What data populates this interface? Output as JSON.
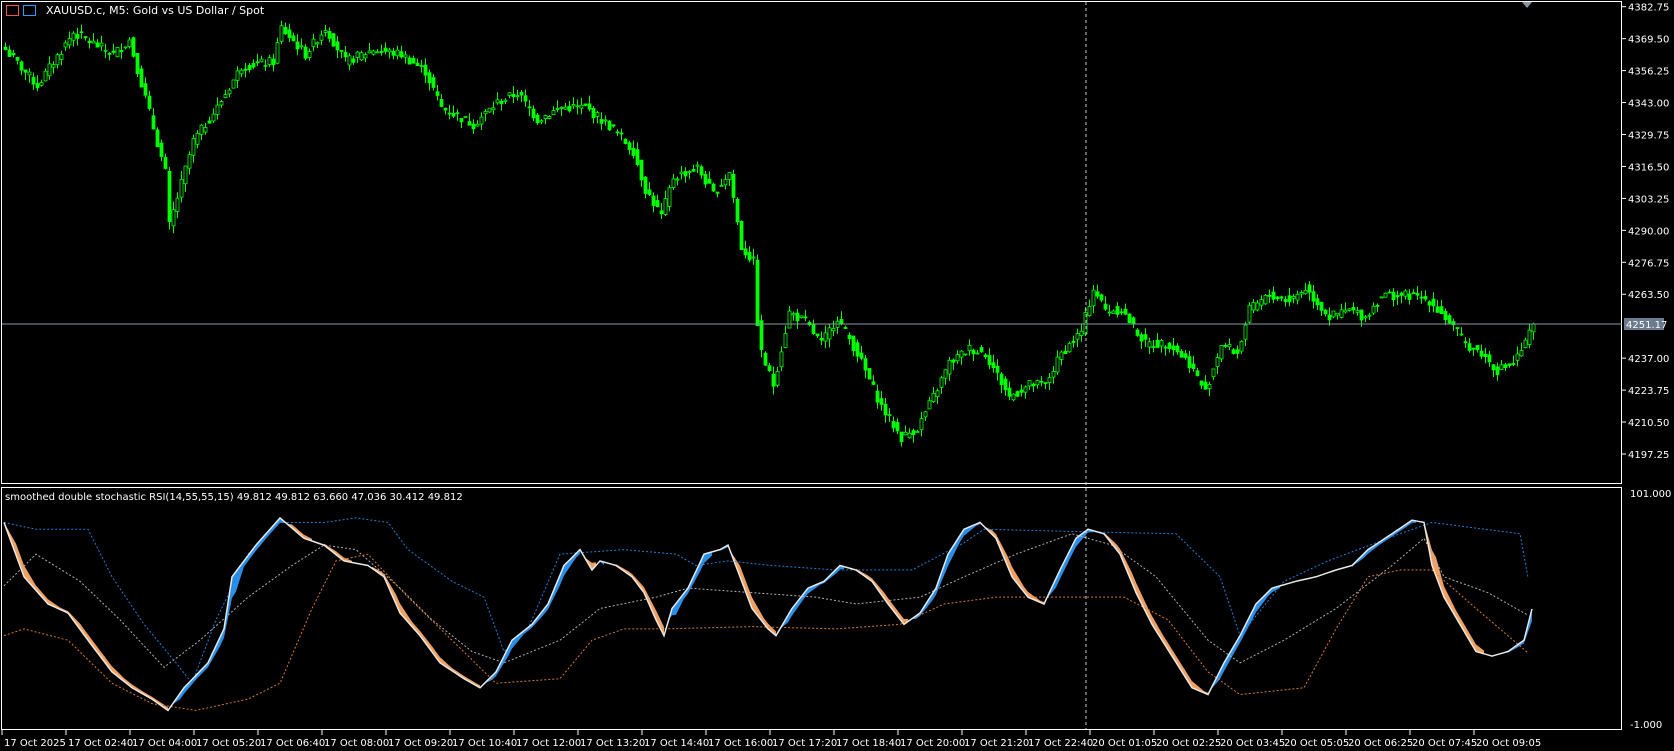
{
  "header": {
    "title": "XAUUSD.c, M5:  Gold vs US Dollar / Spot",
    "icons": [
      "chart-list-icon",
      "symbol-info-icon"
    ]
  },
  "indicator": {
    "title": "smoothed double stochastic RSI(14,55,55,15) 49.812 49.812 63.660 47.036 30.412 49.812"
  },
  "colors": {
    "candle": "#00ff00",
    "main": "#e8e8e8",
    "fill_up": "#2a8fe8",
    "fill_down": "#f0a060",
    "sig_blue": "#1e7fd8",
    "sig_gray": "#b0b0b0",
    "sig_orange": "#d87a30",
    "grid": "#ffffff",
    "current_price_bg": "#6b7a8c"
  },
  "chart_data": [
    {
      "type": "candlestick",
      "symbol": "XAUUSD.c",
      "timeframe": "M5",
      "ylim": [
        4190,
        4385
      ],
      "yticks": [
        "4382.75",
        "4369.50",
        "4356.25",
        "4343.00",
        "4329.75",
        "4316.50",
        "4303.25",
        "4290.00",
        "4276.75",
        "4263.50",
        "4237.00",
        "4223.75",
        "4210.50",
        "4197.25"
      ],
      "ytick_values": [
        4382.75,
        4369.5,
        4356.25,
        4343,
        4329.75,
        4316.5,
        4303.25,
        4290,
        4276.75,
        4263.5,
        4237,
        4223.75,
        4210.5,
        4197.25
      ],
      "current_price": "4251.17",
      "current_price_value": 4251.17,
      "close_anchors_bar_price": [
        [
          0,
          4365
        ],
        [
          8,
          4350
        ],
        [
          17,
          4372
        ],
        [
          27,
          4363
        ],
        [
          31,
          4369
        ],
        [
          35,
          4345
        ],
        [
          40,
          4314
        ],
        [
          41,
          4292
        ],
        [
          47,
          4327
        ],
        [
          53,
          4341
        ],
        [
          59,
          4358
        ],
        [
          67,
          4360
        ],
        [
          69,
          4374
        ],
        [
          75,
          4363
        ],
        [
          80,
          4374
        ],
        [
          85,
          4360
        ],
        [
          92,
          4365
        ],
        [
          99,
          4363
        ],
        [
          105,
          4356
        ],
        [
          109,
          4341
        ],
        [
          117,
          4334
        ],
        [
          123,
          4343
        ],
        [
          128,
          4347
        ],
        [
          133,
          4336
        ],
        [
          139,
          4341
        ],
        [
          145,
          4341
        ],
        [
          152,
          4332
        ],
        [
          157,
          4323
        ],
        [
          160,
          4307
        ],
        [
          164,
          4296
        ],
        [
          167,
          4312
        ],
        [
          173,
          4316
        ],
        [
          177,
          4305
        ],
        [
          181,
          4314
        ],
        [
          184,
          4283
        ],
        [
          187,
          4277
        ],
        [
          188,
          4252
        ],
        [
          189,
          4239
        ],
        [
          192,
          4226
        ],
        [
          196,
          4256
        ],
        [
          200,
          4252
        ],
        [
          204,
          4243
        ],
        [
          208,
          4254
        ],
        [
          213,
          4239
        ],
        [
          219,
          4217
        ],
        [
          224,
          4204
        ],
        [
          228,
          4208
        ],
        [
          232,
          4221
        ],
        [
          236,
          4235
        ],
        [
          241,
          4241
        ],
        [
          245,
          4239
        ],
        [
          251,
          4221
        ],
        [
          256,
          4226
        ],
        [
          260,
          4226
        ],
        [
          264,
          4239
        ],
        [
          269,
          4248
        ],
        [
          272,
          4266
        ],
        [
          275,
          4257
        ],
        [
          279,
          4257
        ],
        [
          285,
          4243
        ],
        [
          291,
          4243
        ],
        [
          296,
          4235
        ],
        [
          300,
          4223
        ],
        [
          304,
          4243
        ],
        [
          308,
          4239
        ],
        [
          311,
          4257
        ],
        [
          316,
          4263
        ],
        [
          321,
          4261
        ],
        [
          325,
          4266
        ],
        [
          331,
          4254
        ],
        [
          336,
          4257
        ],
        [
          340,
          4254
        ],
        [
          344,
          4263
        ],
        [
          351,
          4263
        ],
        [
          356,
          4261
        ],
        [
          361,
          4252
        ],
        [
          365,
          4243
        ],
        [
          369,
          4239
        ],
        [
          373,
          4232
        ],
        [
          377,
          4235
        ],
        [
          380,
          4243
        ],
        [
          382,
          4251.17
        ]
      ]
    },
    {
      "type": "line",
      "title": "smoothed double stochastic RSI(14,55,55,15)",
      "ylim": [
        -1,
        101
      ],
      "yticks": [
        "101.000",
        "-1.000"
      ],
      "ytick_values": [
        101,
        -1
      ],
      "series": [
        {
          "name": "main",
          "values": [
            [
              0,
              88
            ],
            [
              5,
              64
            ],
            [
              11,
              52
            ],
            [
              16,
              48
            ],
            [
              21,
              36
            ],
            [
              27,
              22
            ],
            [
              32,
              15
            ],
            [
              37,
              10
            ],
            [
              41,
              5
            ],
            [
              45,
              15
            ],
            [
              51,
              26
            ],
            [
              55,
              41
            ],
            [
              57,
              64
            ],
            [
              63,
              78
            ],
            [
              69,
              90
            ],
            [
              75,
              81
            ],
            [
              80,
              78
            ],
            [
              85,
              71
            ],
            [
              91,
              69
            ],
            [
              95,
              64
            ],
            [
              99,
              48
            ],
            [
              104,
              38
            ],
            [
              109,
              26
            ],
            [
              115,
              19
            ],
            [
              119,
              15
            ],
            [
              123,
              22
            ],
            [
              127,
              36
            ],
            [
              132,
              43
            ],
            [
              136,
              52
            ],
            [
              140,
              69
            ],
            [
              144,
              76
            ],
            [
              147,
              67
            ],
            [
              149,
              71
            ],
            [
              153,
              69
            ],
            [
              157,
              64
            ],
            [
              160,
              57
            ],
            [
              163,
              45
            ],
            [
              165,
              38
            ],
            [
              167,
              50
            ],
            [
              171,
              59
            ],
            [
              175,
              74
            ],
            [
              179,
              76
            ],
            [
              181,
              78
            ],
            [
              184,
              64
            ],
            [
              187,
              50
            ],
            [
              191,
              41
            ],
            [
              193,
              38
            ],
            [
              197,
              50
            ],
            [
              201,
              59
            ],
            [
              205,
              62
            ],
            [
              209,
              69
            ],
            [
              213,
              67
            ],
            [
              217,
              62
            ],
            [
              221,
              52
            ],
            [
              225,
              43
            ],
            [
              229,
              48
            ],
            [
              233,
              59
            ],
            [
              236,
              74
            ],
            [
              240,
              85
            ],
            [
              244,
              88
            ],
            [
              248,
              81
            ],
            [
              252,
              64
            ],
            [
              256,
              55
            ],
            [
              260,
              52
            ],
            [
              264,
              67
            ],
            [
              268,
              81
            ],
            [
              271,
              85
            ],
            [
              275,
              83
            ],
            [
              279,
              74
            ],
            [
              283,
              57
            ],
            [
              287,
              43
            ],
            [
              292,
              29
            ],
            [
              297,
              15
            ],
            [
              301,
              12
            ],
            [
              305,
              26
            ],
            [
              309,
              38
            ],
            [
              313,
              52
            ],
            [
              317,
              59
            ],
            [
              323,
              62
            ],
            [
              328,
              64
            ],
            [
              333,
              67
            ],
            [
              337,
              69
            ],
            [
              341,
              76
            ],
            [
              347,
              83
            ],
            [
              352,
              89
            ],
            [
              355,
              88
            ],
            [
              357,
              69
            ],
            [
              360,
              55
            ],
            [
              364,
              43
            ],
            [
              368,
              31
            ],
            [
              372,
              29
            ],
            [
              376,
              31
            ],
            [
              380,
              36
            ],
            [
              382,
              49.812
            ]
          ]
        },
        {
          "name": "upper",
          "values": [
            [
              0,
              88
            ],
            [
              8,
              85
            ],
            [
              21,
              85
            ],
            [
              27,
              64
            ],
            [
              35,
              43
            ],
            [
              43,
              26
            ],
            [
              47,
              17
            ],
            [
              53,
              45
            ],
            [
              61,
              74
            ],
            [
              69,
              88
            ],
            [
              80,
              88
            ],
            [
              88,
              90
            ],
            [
              96,
              88
            ],
            [
              101,
              76
            ],
            [
              112,
              62
            ],
            [
              120,
              55
            ],
            [
              125,
              31
            ],
            [
              131,
              41
            ],
            [
              139,
              74
            ],
            [
              155,
              76
            ],
            [
              168,
              74
            ],
            [
              173,
              69
            ],
            [
              181,
              71
            ],
            [
              192,
              69
            ],
            [
              208,
              67
            ],
            [
              227,
              67
            ],
            [
              240,
              79
            ],
            [
              245,
              85
            ],
            [
              267,
              84
            ],
            [
              293,
              83
            ],
            [
              304,
              64
            ],
            [
              309,
              38
            ],
            [
              320,
              62
            ],
            [
              331,
              71
            ],
            [
              349,
              83
            ],
            [
              357,
              88
            ],
            [
              379,
              83
            ],
            [
              381,
              63.66
            ]
          ]
        },
        {
          "name": "middle",
          "values": [
            [
              0,
              60
            ],
            [
              8,
              74
            ],
            [
              19,
              62
            ],
            [
              29,
              45
            ],
            [
              40,
              24
            ],
            [
              49,
              36
            ],
            [
              61,
              55
            ],
            [
              72,
              69
            ],
            [
              80,
              78
            ],
            [
              88,
              76
            ],
            [
              99,
              59
            ],
            [
              107,
              45
            ],
            [
              117,
              31
            ],
            [
              125,
              26
            ],
            [
              139,
              36
            ],
            [
              149,
              50
            ],
            [
              163,
              55
            ],
            [
              171,
              59
            ],
            [
              187,
              57
            ],
            [
              203,
              55
            ],
            [
              213,
              52
            ],
            [
              229,
              55
            ],
            [
              240,
              64
            ],
            [
              253,
              74
            ],
            [
              267,
              83
            ],
            [
              277,
              78
            ],
            [
              288,
              64
            ],
            [
              301,
              36
            ],
            [
              309,
              26
            ],
            [
              320,
              36
            ],
            [
              333,
              50
            ],
            [
              347,
              69
            ],
            [
              355,
              81
            ],
            [
              360,
              64
            ],
            [
              371,
              57
            ],
            [
              381,
              47.036
            ]
          ]
        },
        {
          "name": "lower",
          "values": [
            [
              0,
              38
            ],
            [
              5,
              41
            ],
            [
              16,
              36
            ],
            [
              27,
              17
            ],
            [
              37,
              8
            ],
            [
              48,
              5
            ],
            [
              61,
              10
            ],
            [
              69,
              17
            ],
            [
              77,
              50
            ],
            [
              83,
              71
            ],
            [
              91,
              74
            ],
            [
              101,
              55
            ],
            [
              112,
              36
            ],
            [
              123,
              17
            ],
            [
              139,
              19
            ],
            [
              147,
              36
            ],
            [
              155,
              41
            ],
            [
              165,
              41
            ],
            [
              187,
              42
            ],
            [
              208,
              41
            ],
            [
              224,
              43
            ],
            [
              235,
              52
            ],
            [
              248,
              55
            ],
            [
              280,
              55
            ],
            [
              291,
              45
            ],
            [
              301,
              22
            ],
            [
              309,
              12
            ],
            [
              325,
              15
            ],
            [
              333,
              41
            ],
            [
              341,
              64
            ],
            [
              349,
              67
            ],
            [
              357,
              67
            ],
            [
              368,
              50
            ],
            [
              381,
              30.412
            ]
          ]
        }
      ]
    }
  ],
  "time_axis": {
    "labels": [
      "17 Oct 2025",
      "17 Oct 02:40",
      "17 Oct 04:00",
      "17 Oct 05:20",
      "17 Oct 06:40",
      "17 Oct 08:00",
      "17 Oct 09:20",
      "17 Oct 10:40",
      "17 Oct 12:00",
      "17 Oct 13:20",
      "17 Oct 14:40",
      "17 Oct 16:00",
      "17 Oct 17:20",
      "17 Oct 18:40",
      "17 Oct 20:00",
      "17 Oct 21:20",
      "17 Oct 22:40",
      "20 Oct 01:05",
      "20 Oct 02:25",
      "20 Oct 03:45",
      "20 Oct 05:05",
      "20 Oct 06:25",
      "20 Oct 07:45",
      "20 Oct 09:05"
    ]
  }
}
